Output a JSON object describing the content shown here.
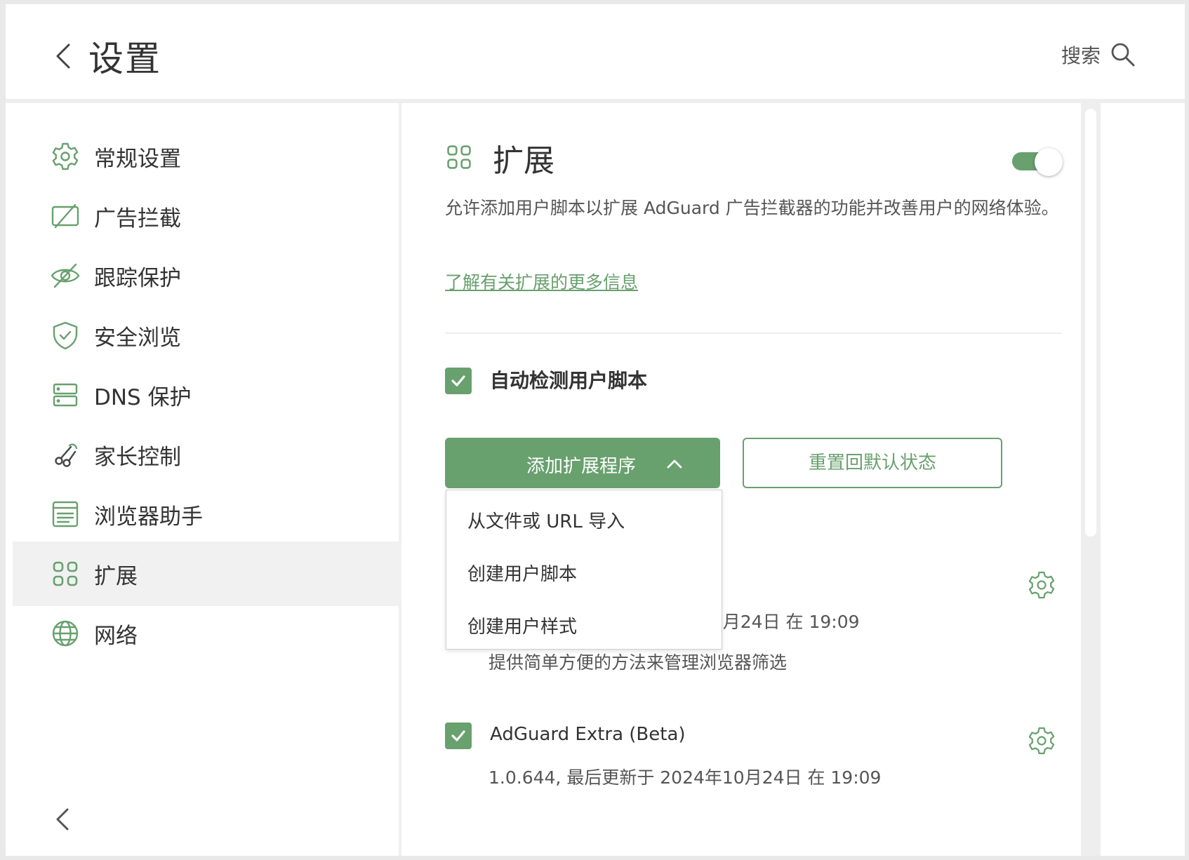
{
  "header": {
    "title": "设置",
    "search_label": "搜索"
  },
  "sidebar": {
    "items": [
      {
        "label": "常规设置",
        "icon": "gear-icon"
      },
      {
        "label": "广告拦截",
        "icon": "ad-block-icon"
      },
      {
        "label": "跟踪保护",
        "icon": "eye-slash-icon"
      },
      {
        "label": "安全浏览",
        "icon": "shield-icon"
      },
      {
        "label": "DNS 保护",
        "icon": "server-icon"
      },
      {
        "label": "家长控制",
        "icon": "parental-icon"
      },
      {
        "label": "浏览器助手",
        "icon": "browser-icon"
      },
      {
        "label": "扩展",
        "icon": "grid-icon",
        "active": true
      },
      {
        "label": "网络",
        "icon": "globe-icon"
      }
    ]
  },
  "main": {
    "title": "扩展",
    "enabled": true,
    "description": "允许添加用户脚本以扩展 AdGuard 广告拦截器的功能并改善用户的网络体验。",
    "learn_more": "了解有关扩展的更多信息",
    "auto_detect_label": "自动检测用户脚本",
    "add_button": "添加扩展程序",
    "reset_button": "重置回默认状态",
    "dropdown": {
      "items": [
        "从文件或 URL 导入",
        "创建用户脚本",
        "创建用户样式"
      ]
    },
    "extensions": [
      {
        "updated_fragment": ")月24日 在 19:09",
        "description": "提供简单方便的方法来管理浏览器筛选"
      },
      {
        "name": "AdGuard Extra (Beta)",
        "meta": "1.0.644,  最后更新于 2024年10月24日 在 19:09"
      }
    ]
  },
  "colors": {
    "accent": "#68a06e",
    "active_bg": "#f1f1f1",
    "text": "#333333"
  }
}
